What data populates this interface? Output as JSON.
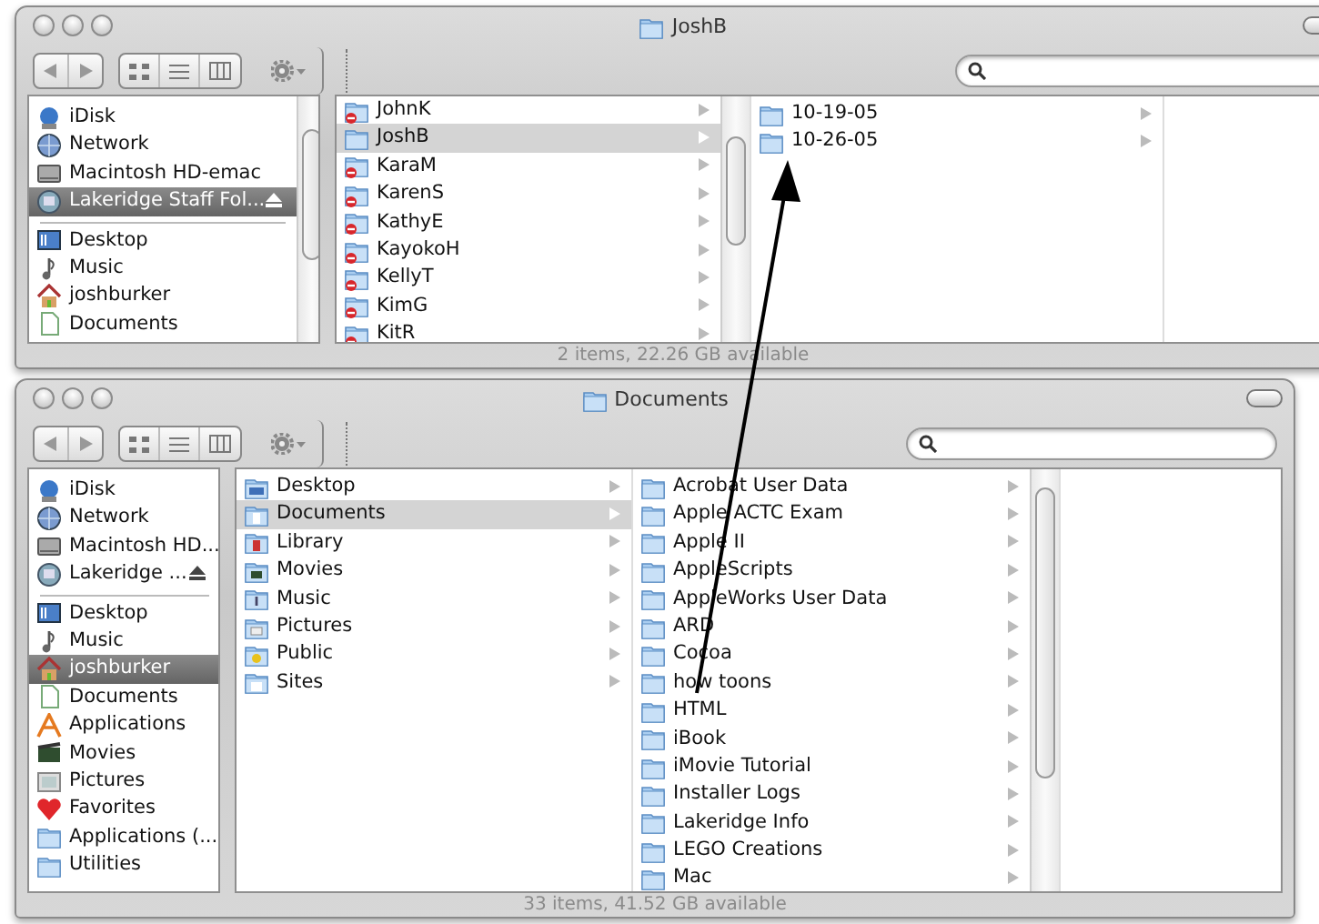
{
  "windows": [
    {
      "title": "JoshB",
      "status": "2 items, 22.26 GB available",
      "sidebar": {
        "devices": [
          {
            "label": "iDisk",
            "kind": "idisk",
            "selected": false,
            "eject": false
          },
          {
            "label": "Network",
            "kind": "network",
            "selected": false,
            "eject": false
          },
          {
            "label": "Macintosh HD-emac",
            "kind": "disk",
            "selected": false,
            "eject": false
          },
          {
            "label": "Lakeridge Staff Fol...",
            "kind": "server",
            "selected": true,
            "eject": true
          }
        ],
        "places": [
          {
            "label": "Desktop",
            "kind": "desktop",
            "selected": false
          },
          {
            "label": "Music",
            "kind": "music",
            "selected": false
          },
          {
            "label": "joshburker",
            "kind": "home",
            "selected": false
          },
          {
            "label": "Documents",
            "kind": "documents",
            "selected": false
          }
        ]
      },
      "columns": [
        {
          "items": [
            {
              "label": "JohnK",
              "kind": "folder",
              "selected": false,
              "locked": true
            },
            {
              "label": "JoshB",
              "kind": "folder",
              "selected": true,
              "locked": false
            },
            {
              "label": "KaraM",
              "kind": "folder",
              "selected": false,
              "locked": true
            },
            {
              "label": "KarenS",
              "kind": "folder",
              "selected": false,
              "locked": true
            },
            {
              "label": "KathyE",
              "kind": "folder",
              "selected": false,
              "locked": true
            },
            {
              "label": "KayokoH",
              "kind": "folder",
              "selected": false,
              "locked": true
            },
            {
              "label": "KellyT",
              "kind": "folder",
              "selected": false,
              "locked": true
            },
            {
              "label": "KimG",
              "kind": "folder",
              "selected": false,
              "locked": true
            },
            {
              "label": "KitR",
              "kind": "folder",
              "selected": false,
              "locked": true
            }
          ]
        },
        {
          "items": [
            {
              "label": "10-19-05",
              "kind": "folder",
              "selected": false,
              "locked": false
            },
            {
              "label": "10-26-05",
              "kind": "folder",
              "selected": false,
              "locked": false
            }
          ]
        }
      ]
    },
    {
      "title": "Documents",
      "status": "33 items, 41.52 GB available",
      "sidebar": {
        "devices": [
          {
            "label": "iDisk",
            "kind": "idisk",
            "selected": false,
            "eject": false
          },
          {
            "label": "Network",
            "kind": "network",
            "selected": false,
            "eject": false
          },
          {
            "label": "Macintosh HD...",
            "kind": "disk",
            "selected": false,
            "eject": false
          },
          {
            "label": "Lakeridge ...",
            "kind": "server",
            "selected": false,
            "eject": true
          }
        ],
        "places": [
          {
            "label": "Desktop",
            "kind": "desktop",
            "selected": false
          },
          {
            "label": "Music",
            "kind": "music",
            "selected": false
          },
          {
            "label": "joshburker",
            "kind": "home",
            "selected": true
          },
          {
            "label": "Documents",
            "kind": "documents",
            "selected": false
          },
          {
            "label": "Applications",
            "kind": "applications",
            "selected": false
          },
          {
            "label": "Movies",
            "kind": "movies",
            "selected": false
          },
          {
            "label": "Pictures",
            "kind": "pictures",
            "selected": false
          },
          {
            "label": "Favorites",
            "kind": "favorites",
            "selected": false
          },
          {
            "label": "Applications (...",
            "kind": "folder",
            "selected": false
          },
          {
            "label": "Utilities",
            "kind": "folder",
            "selected": false
          }
        ]
      },
      "columns": [
        {
          "items": [
            {
              "label": "Desktop",
              "kind": "desktop",
              "selected": false
            },
            {
              "label": "Documents",
              "kind": "documents",
              "selected": true
            },
            {
              "label": "Library",
              "kind": "library",
              "selected": false
            },
            {
              "label": "Movies",
              "kind": "movies",
              "selected": false
            },
            {
              "label": "Music",
              "kind": "music",
              "selected": false
            },
            {
              "label": "Pictures",
              "kind": "pictures",
              "selected": false
            },
            {
              "label": "Public",
              "kind": "public",
              "selected": false
            },
            {
              "label": "Sites",
              "kind": "sites",
              "selected": false
            }
          ]
        },
        {
          "items": [
            {
              "label": "Acrobat User Data",
              "kind": "folder",
              "selected": false
            },
            {
              "label": "Apple ACTC Exam",
              "kind": "folder",
              "selected": false
            },
            {
              "label": "Apple II",
              "kind": "folder",
              "selected": false
            },
            {
              "label": "AppleScripts",
              "kind": "folder",
              "selected": false
            },
            {
              "label": "AppleWorks User Data",
              "kind": "folder",
              "selected": false
            },
            {
              "label": "ARD",
              "kind": "folder",
              "selected": false
            },
            {
              "label": "Cocoa",
              "kind": "folder",
              "selected": false
            },
            {
              "label": "how toons",
              "kind": "folder",
              "selected": false
            },
            {
              "label": "HTML",
              "kind": "folder",
              "selected": false
            },
            {
              "label": "iBook",
              "kind": "folder",
              "selected": false
            },
            {
              "label": "iMovie Tutorial",
              "kind": "folder",
              "selected": false
            },
            {
              "label": "Installer Logs",
              "kind": "folder",
              "selected": false
            },
            {
              "label": "Lakeridge Info",
              "kind": "folder",
              "selected": false
            },
            {
              "label": "LEGO Creations",
              "kind": "folder",
              "selected": false
            },
            {
              "label": "Mac",
              "kind": "folder",
              "selected": false
            }
          ]
        }
      ]
    }
  ]
}
